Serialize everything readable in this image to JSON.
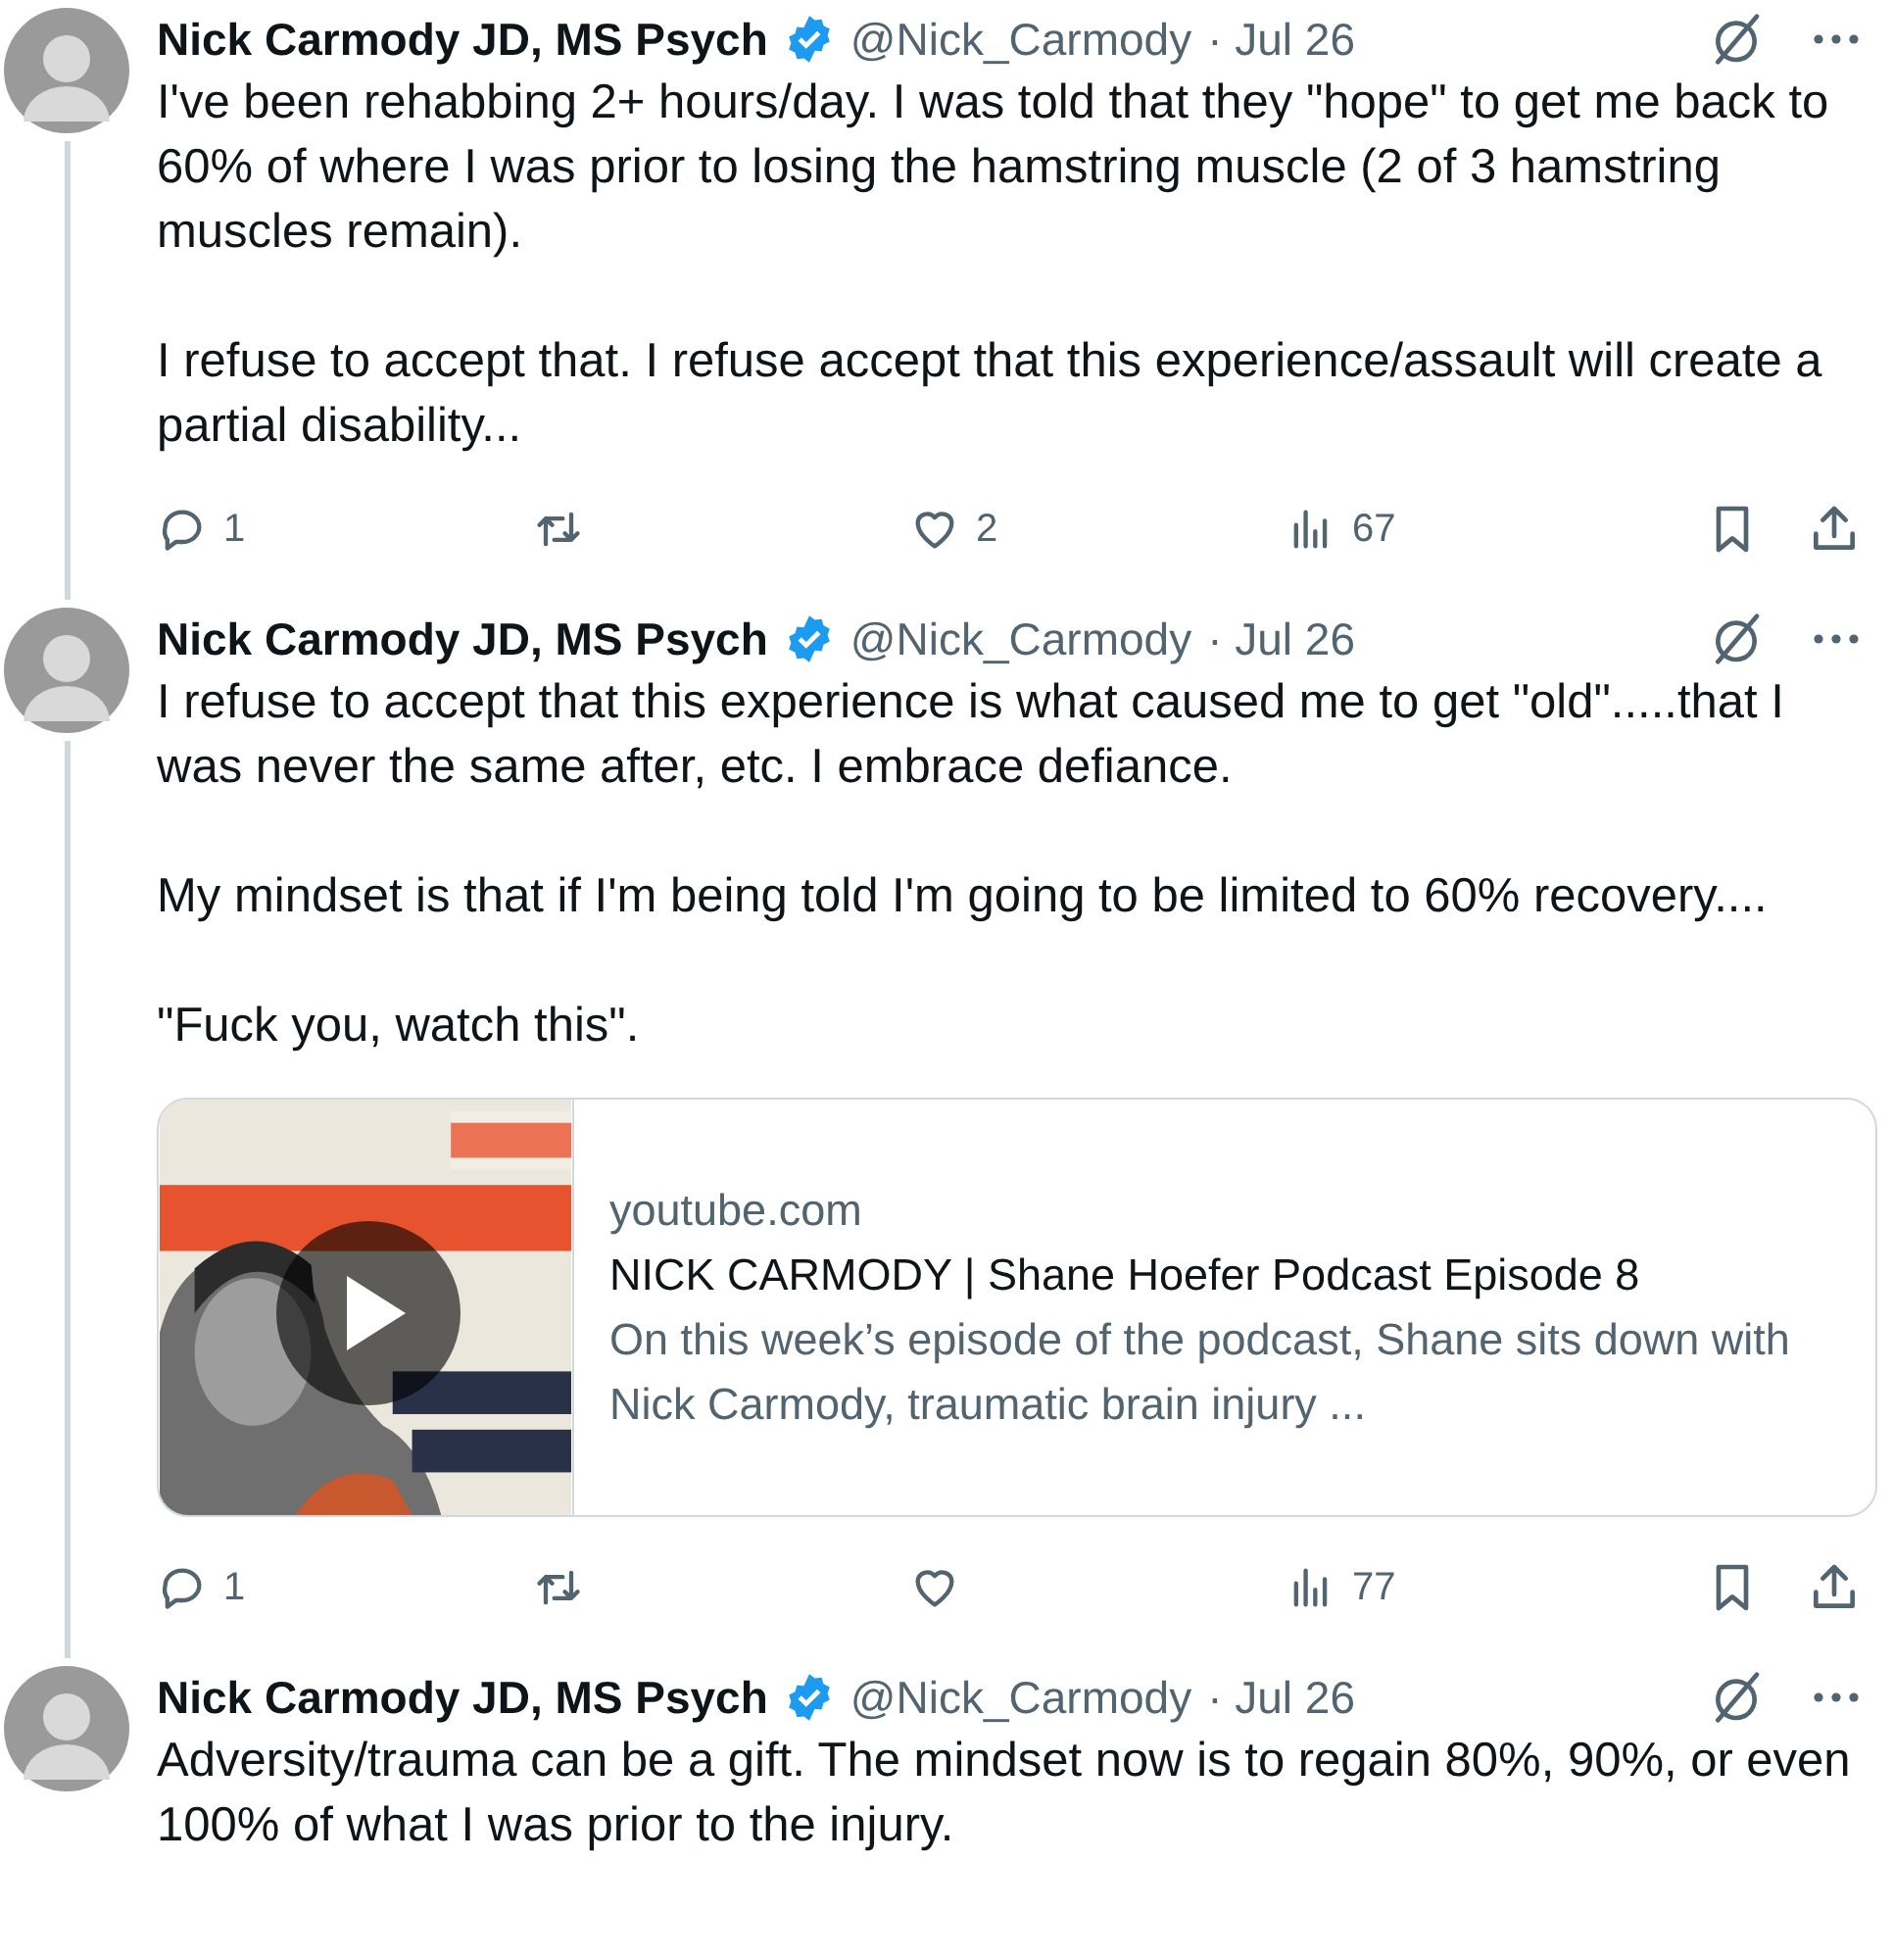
{
  "tweets": [
    {
      "author": "Nick Carmody JD, MS Psych",
      "verified": true,
      "handle": "@Nick_Carmody",
      "date": "· Jul 26",
      "body": [
        "I've been rehabbing 2+ hours/day.  I was told that they \"hope\" to get me back to 60% of where I was prior to losing the hamstring muscle (2 of 3 hamstring muscles remain).",
        "I refuse to accept that.  I refuse accept that this experience/assault will create a partial disability..."
      ],
      "replies": "1",
      "likes": "2",
      "views": "67",
      "thread_continues": true
    },
    {
      "author": "Nick Carmody JD, MS Psych",
      "verified": true,
      "handle": "@Nick_Carmody",
      "date": "· Jul 26",
      "body": [
        "I refuse to accept that this experience is what caused me to get \"old\".....that I was never the same after, etc.  I embrace defiance.",
        "My mindset is that if I'm being told I'm going to be limited to 60% recovery....",
        "\"Fuck you, watch this\"."
      ],
      "link_card": {
        "kind": "video",
        "domain": "youtube.com",
        "title": "NICK CARMODY | Shane Hoefer Podcast Episode 8",
        "description": "On this week’s episode of the podcast, Shane sits down with Nick Carmody, traumatic brain injury ..."
      },
      "replies": "1",
      "views": "77",
      "thread_continues": true
    },
    {
      "author": "Nick Carmody JD, MS Psych",
      "verified": true,
      "handle": "@Nick_Carmody",
      "date": "· Jul 26",
      "body": [
        "Adversity/trauma can be a gift.  The mindset now is to regain 80%, 90%, or even 100% of what I was prior to the injury."
      ]
    }
  ]
}
